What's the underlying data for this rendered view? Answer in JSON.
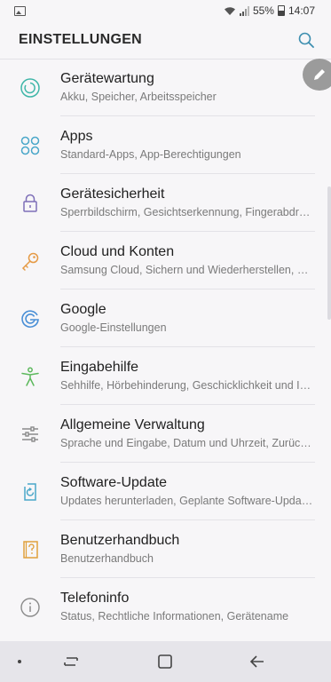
{
  "status_bar": {
    "battery": "55%",
    "time": "14:07"
  },
  "header": {
    "title": "EINSTELLUNGEN",
    "search_icon": "search-icon"
  },
  "fab": {
    "icon": "pencil-icon"
  },
  "items": [
    {
      "icon": "device-care-icon",
      "title": "Gerätewartung",
      "subtitle": "Akku, Speicher, Arbeitsspeicher",
      "color": "#3fb6a8"
    },
    {
      "icon": "apps-icon",
      "title": "Apps",
      "subtitle": "Standard-Apps, App-Berechtigungen",
      "color": "#4aa7c9"
    },
    {
      "icon": "lock-icon",
      "title": "Gerätesicherheit",
      "subtitle": "Sperrbildschirm, Gesichtserkennung, Fingerabdrucksensor",
      "color": "#7e6fb8"
    },
    {
      "icon": "key-icon",
      "title": "Cloud und Konten",
      "subtitle": "Samsung Cloud, Sichern und Wiederherstellen, Smart Switch",
      "color": "#e59a45"
    },
    {
      "icon": "google-icon",
      "title": "Google",
      "subtitle": "Google-Einstellungen",
      "color": "#4a8fd6"
    },
    {
      "icon": "accessibility-icon",
      "title": "Eingabehilfe",
      "subtitle": "Sehhilfe, Hörbehinderung, Geschicklichkeit und Interaktion",
      "color": "#5cb85c"
    },
    {
      "icon": "sliders-icon",
      "title": "Allgemeine Verwaltung",
      "subtitle": "Sprache und Eingabe, Datum und Uhrzeit, Zurücksetzen",
      "color": "#8a8a8a"
    },
    {
      "icon": "software-update-icon",
      "title": "Software-Update",
      "subtitle": "Updates herunterladen, Geplante Software-Updates",
      "color": "#4aa7c9"
    },
    {
      "icon": "manual-icon",
      "title": "Benutzerhandbuch",
      "subtitle": "Benutzerhandbuch",
      "color": "#e0a03c"
    },
    {
      "icon": "info-icon",
      "title": "Telefoninfo",
      "subtitle": "Status, Rechtliche Informationen, Gerätename",
      "color": "#8a8a8a"
    }
  ],
  "nav": {
    "recents": "recents-icon",
    "home": "home-icon",
    "back": "back-icon"
  }
}
